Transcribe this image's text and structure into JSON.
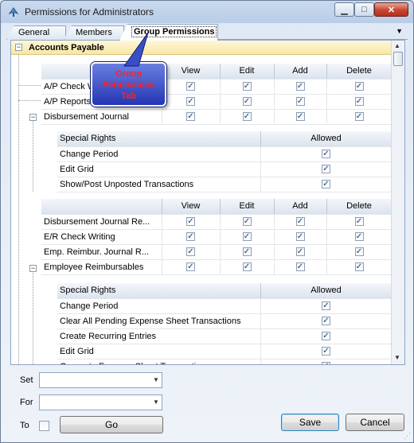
{
  "window": {
    "title": "Permissions for Administrators"
  },
  "tabs": [
    {
      "label": "General"
    },
    {
      "label": "Members"
    },
    {
      "label": "Group Permissions"
    }
  ],
  "callout": {
    "line1": "Group",
    "line2": "Permissions",
    "line3": "Tab"
  },
  "group": {
    "label": "Accounts Payable",
    "expander": "−"
  },
  "perm_columns": [
    "View",
    "Edit",
    "Add",
    "Delete"
  ],
  "special_columns": {
    "rights": "Special Rights",
    "allowed": "Allowed"
  },
  "section1": {
    "rows": [
      "A/P Check W",
      "A/P Reports",
      "Disbursement Journal"
    ],
    "checks": [
      [
        true,
        true,
        true,
        true
      ],
      [
        true,
        true,
        true,
        true
      ],
      [
        true,
        true,
        true,
        true
      ]
    ]
  },
  "special1": {
    "rows": [
      "Change Period",
      "Edit Grid",
      "Show/Post Unposted Transactions"
    ],
    "allowed": [
      true,
      true,
      true
    ]
  },
  "section2": {
    "rows": [
      "Disbursement Journal Re...",
      "E/R Check Writing",
      "Emp. Reimbur. Journal R...",
      "Employee Reimbursables"
    ],
    "checks": [
      [
        true,
        true,
        true,
        true
      ],
      [
        true,
        true,
        true,
        true
      ],
      [
        true,
        true,
        true,
        true
      ],
      [
        true,
        true,
        true,
        true
      ]
    ]
  },
  "special2": {
    "rows": [
      "Change Period",
      "Clear All Pending Expense Sheet Transactions",
      "Create Recurring Entries",
      "Edit Grid",
      "Generate Expense Sheet Transactions"
    ],
    "allowed": [
      true,
      true,
      true,
      true,
      true
    ]
  },
  "bottom": {
    "set_label": "Set",
    "set_value": "",
    "for_label": "For",
    "for_value": "",
    "to_label": "To",
    "to_checked": false,
    "go_label": "Go",
    "save_label": "Save",
    "cancel_label": "Cancel"
  }
}
